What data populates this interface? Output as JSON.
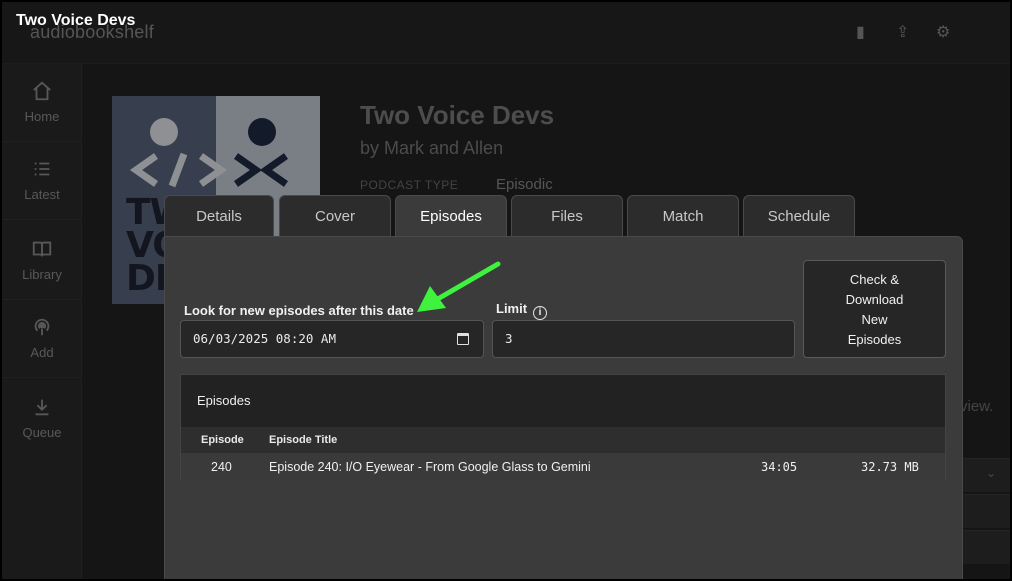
{
  "window": {
    "title": "Two Voice Devs"
  },
  "app": {
    "brand": "audiobookshelf",
    "sidebar": [
      {
        "label": "Home",
        "icon": "home-icon"
      },
      {
        "label": "Latest",
        "icon": "list-icon"
      },
      {
        "label": "Library",
        "icon": "book-icon"
      },
      {
        "label": "Add",
        "icon": "podcast-icon"
      },
      {
        "label": "Queue",
        "icon": "download-icon"
      }
    ],
    "podcast": {
      "title": "Two Voice Devs",
      "author": "by Mark and Allen",
      "type_label": "PODCAST TYPE",
      "type_value": "Episodic",
      "cover_text": [
        "TWO",
        "VOICE",
        "DEVS"
      ]
    },
    "background_fragment": "view."
  },
  "tabs": [
    {
      "label": "Details",
      "active": false
    },
    {
      "label": "Cover",
      "active": false
    },
    {
      "label": "Episodes",
      "active": true
    },
    {
      "label": "Files",
      "active": false
    },
    {
      "label": "Match",
      "active": false
    },
    {
      "label": "Schedule",
      "active": false
    }
  ],
  "episodes_tab": {
    "date_label": "Look for new episodes after this date",
    "date_value": "06/03/2025 08:20 AM",
    "limit_label": "Limit",
    "limit_value": "3",
    "check_button": [
      "Check &",
      "Download",
      "New",
      "Episodes"
    ],
    "panel_title": "Episodes",
    "columns": {
      "episode": "Episode",
      "title": "Episode Title"
    },
    "rows": [
      {
        "episode": "240",
        "title": "Episode 240: I/O Eyewear - From Google Glass to Gemini",
        "duration": "34:05",
        "size": "32.73 MB"
      }
    ]
  },
  "annotation": {
    "arrow_color": "#3ef23e"
  }
}
